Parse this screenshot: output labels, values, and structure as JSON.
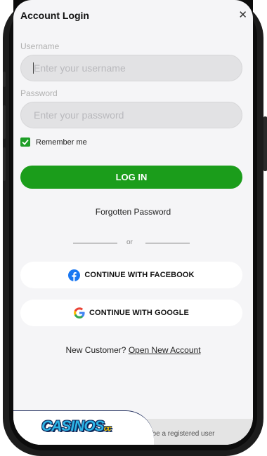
{
  "modal": {
    "title": "Account Login",
    "close_icon": "close-icon"
  },
  "username": {
    "label": "Username",
    "placeholder": "Enter your username"
  },
  "password": {
    "label": "Password",
    "placeholder": "Enter your password"
  },
  "remember": {
    "label": "Remember me",
    "checked": true
  },
  "login_button": "LOG IN",
  "forgot_password": "Forgotten Password",
  "divider_text": "or",
  "facebook_button": "CONTINUE WITH FACEBOOK",
  "google_button": "CONTINUE WITH GOOGLE",
  "new_customer": {
    "prefix": "New Customer?",
    "link": "Open New Account"
  },
  "bottom_note": "st be a registered user",
  "logo": {
    "text": "CASINOS",
    "suffix": "cc"
  },
  "colors": {
    "accent_green": "#1b9d1b",
    "facebook_blue": "#1877f2"
  }
}
